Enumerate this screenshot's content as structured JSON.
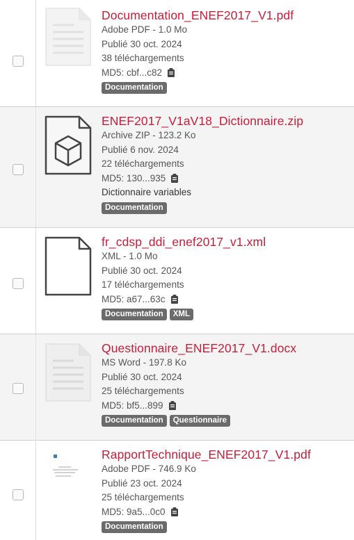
{
  "resources": [
    {
      "name": "Documentation_ENEF2017_V1.pdf",
      "type": "Adobe PDF - 1.0 Mo",
      "published": "Publié 30 oct. 2024",
      "downloads": "38 téléchargements",
      "md5": "MD5: cbf...c82",
      "description": "",
      "tags": [
        "Documentation"
      ],
      "thumbnail": "document-page-icon"
    },
    {
      "name": "ENEF2017_V1aV18_Dictionnaire.zip",
      "type": "Archive ZIP - 123.2 Ko",
      "published": "Publié 6 nov. 2024",
      "downloads": "22 téléchargements",
      "md5": "MD5: 130...935",
      "description": "Dictionnaire variables",
      "tags": [
        "Documentation"
      ],
      "thumbnail": "archive-box-icon"
    },
    {
      "name": "fr_cdsp_ddi_enef2017_v1.xml",
      "type": "XML - 1.0 Mo",
      "published": "Publié 30 oct. 2024",
      "downloads": "17 téléchargements",
      "md5": "MD5: a67...63c",
      "description": "",
      "tags": [
        "Documentation",
        "XML"
      ],
      "thumbnail": "blank-file-icon"
    },
    {
      "name": "Questionnaire_ENEF2017_V1.docx",
      "type": "MS Word - 197.8 Ko",
      "published": "Publié 30 oct. 2024",
      "downloads": "25 téléchargements",
      "md5": "MD5: bf5...899",
      "description": "",
      "tags": [
        "Documentation",
        "Questionnaire"
      ],
      "thumbnail": "document-page-icon"
    },
    {
      "name": "RapportTechnique_ENEF2017_V1.pdf",
      "type": "Adobe PDF - 746.9 Ko",
      "published": "Publié 23 oct. 2024",
      "downloads": "25 téléchargements",
      "md5": "MD5: 9a5...0c0",
      "description": "",
      "tags": [
        "Documentation"
      ],
      "thumbnail": "report-preview-thumbnail"
    }
  ],
  "colors": {
    "link": "#c41e3a",
    "tag_background": "#6b6b6b",
    "shaded_row": "#f4f4f4"
  }
}
